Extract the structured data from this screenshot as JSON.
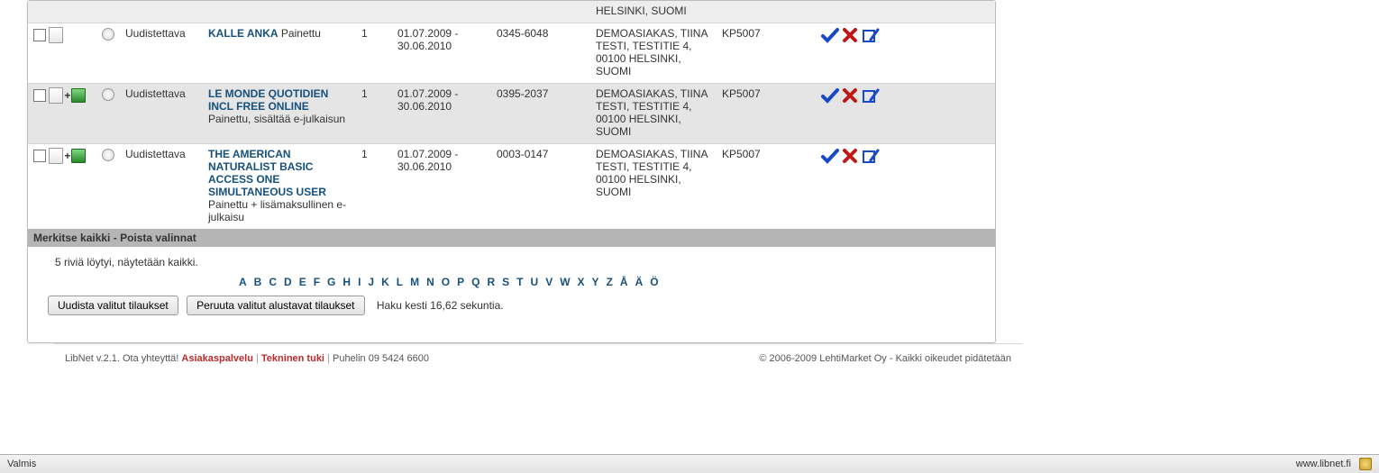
{
  "rows": [
    {
      "status": "Uudistettava",
      "title": "KALLE ANKA",
      "format": "Painettu",
      "qty": "1",
      "period": "01.07.2009 - 30.06.2010",
      "issn": "0345-6048",
      "customer": "DEMOASIAKAS, TIINA TESTI, TESTITIE 4, 00100 HELSINKI, SUOMI",
      "code": "KP5007",
      "has_plus": false
    },
    {
      "status": "Uudistettava",
      "title": "LE MONDE QUOTIDIEN INCL FREE ONLINE",
      "format": "Painettu, sisältää e-julkaisun",
      "qty": "1",
      "period": "01.07.2009 - 30.06.2010",
      "issn": "0395-2037",
      "customer": "DEMOASIAKAS, TIINA TESTI, TESTITIE 4, 00100 HELSINKI, SUOMI",
      "code": "KP5007",
      "has_plus": true
    },
    {
      "status": "Uudistettava",
      "title": "THE AMERICAN NATURALIST BASIC ACCESS ONE SIMULTANEOUS USER",
      "format": "Painettu + lisämaksullinen e-julkaisu",
      "qty": "1",
      "period": "01.07.2009 - 30.06.2010",
      "issn": "0003-0147",
      "customer": "DEMOASIAKAS, TIINA TESTI, TESTITIE 4, 00100 HELSINKI, SUOMI",
      "code": "KP5007",
      "has_plus": true
    }
  ],
  "partial_row_customer": "HELSINKI, SUOMI",
  "selectbar": {
    "select_all": "Merkitse kaikki",
    "sep": " - ",
    "clear": "Poista valinnat"
  },
  "summary": "5 riviä löytyi, näytetään kaikki.",
  "alpha": [
    "A",
    "B",
    "C",
    "D",
    "E",
    "F",
    "G",
    "H",
    "I",
    "J",
    "K",
    "L",
    "M",
    "N",
    "O",
    "P",
    "Q",
    "R",
    "S",
    "T",
    "U",
    "V",
    "W",
    "X",
    "Y",
    "Z",
    "Å",
    "Ä",
    "Ö"
  ],
  "buttons": {
    "renew": "Uudista valitut tilaukset",
    "cancel": "Peruuta valitut alustavat tilaukset"
  },
  "search_info": "Haku kesti 16,62 sekuntia.",
  "footer": {
    "left_prefix": "LibNet v.2.1. Ota yhteyttä! ",
    "link1": "Asiakaspalvelu",
    "link2": "Tekninen tuki",
    "phone": "Puhelin 09 5424 6600",
    "right": "© 2006-2009 LehtiMarket Oy - Kaikki oikeudet pidätetään"
  },
  "statusbar": {
    "left": "Valmis",
    "right": "www.libnet.fi"
  }
}
